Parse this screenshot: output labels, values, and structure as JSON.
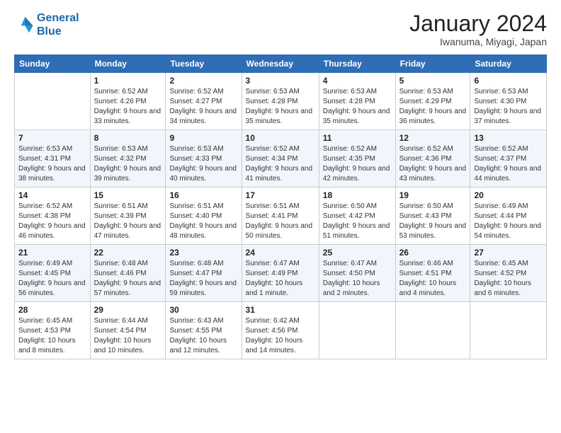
{
  "logo": {
    "line1": "General",
    "line2": "Blue"
  },
  "title": "January 2024",
  "location": "Iwanuma, Miyagi, Japan",
  "days_of_week": [
    "Sunday",
    "Monday",
    "Tuesday",
    "Wednesday",
    "Thursday",
    "Friday",
    "Saturday"
  ],
  "weeks": [
    [
      {
        "day": "",
        "sunrise": "",
        "sunset": "",
        "daylight": ""
      },
      {
        "day": "1",
        "sunrise": "Sunrise: 6:52 AM",
        "sunset": "Sunset: 4:26 PM",
        "daylight": "Daylight: 9 hours and 33 minutes."
      },
      {
        "day": "2",
        "sunrise": "Sunrise: 6:52 AM",
        "sunset": "Sunset: 4:27 PM",
        "daylight": "Daylight: 9 hours and 34 minutes."
      },
      {
        "day": "3",
        "sunrise": "Sunrise: 6:53 AM",
        "sunset": "Sunset: 4:28 PM",
        "daylight": "Daylight: 9 hours and 35 minutes."
      },
      {
        "day": "4",
        "sunrise": "Sunrise: 6:53 AM",
        "sunset": "Sunset: 4:28 PM",
        "daylight": "Daylight: 9 hours and 35 minutes."
      },
      {
        "day": "5",
        "sunrise": "Sunrise: 6:53 AM",
        "sunset": "Sunset: 4:29 PM",
        "daylight": "Daylight: 9 hours and 36 minutes."
      },
      {
        "day": "6",
        "sunrise": "Sunrise: 6:53 AM",
        "sunset": "Sunset: 4:30 PM",
        "daylight": "Daylight: 9 hours and 37 minutes."
      }
    ],
    [
      {
        "day": "7",
        "sunrise": "Sunrise: 6:53 AM",
        "sunset": "Sunset: 4:31 PM",
        "daylight": "Daylight: 9 hours and 38 minutes."
      },
      {
        "day": "8",
        "sunrise": "Sunrise: 6:53 AM",
        "sunset": "Sunset: 4:32 PM",
        "daylight": "Daylight: 9 hours and 39 minutes."
      },
      {
        "day": "9",
        "sunrise": "Sunrise: 6:53 AM",
        "sunset": "Sunset: 4:33 PM",
        "daylight": "Daylight: 9 hours and 40 minutes."
      },
      {
        "day": "10",
        "sunrise": "Sunrise: 6:52 AM",
        "sunset": "Sunset: 4:34 PM",
        "daylight": "Daylight: 9 hours and 41 minutes."
      },
      {
        "day": "11",
        "sunrise": "Sunrise: 6:52 AM",
        "sunset": "Sunset: 4:35 PM",
        "daylight": "Daylight: 9 hours and 42 minutes."
      },
      {
        "day": "12",
        "sunrise": "Sunrise: 6:52 AM",
        "sunset": "Sunset: 4:36 PM",
        "daylight": "Daylight: 9 hours and 43 minutes."
      },
      {
        "day": "13",
        "sunrise": "Sunrise: 6:52 AM",
        "sunset": "Sunset: 4:37 PM",
        "daylight": "Daylight: 9 hours and 44 minutes."
      }
    ],
    [
      {
        "day": "14",
        "sunrise": "Sunrise: 6:52 AM",
        "sunset": "Sunset: 4:38 PM",
        "daylight": "Daylight: 9 hours and 46 minutes."
      },
      {
        "day": "15",
        "sunrise": "Sunrise: 6:51 AM",
        "sunset": "Sunset: 4:39 PM",
        "daylight": "Daylight: 9 hours and 47 minutes."
      },
      {
        "day": "16",
        "sunrise": "Sunrise: 6:51 AM",
        "sunset": "Sunset: 4:40 PM",
        "daylight": "Daylight: 9 hours and 48 minutes."
      },
      {
        "day": "17",
        "sunrise": "Sunrise: 6:51 AM",
        "sunset": "Sunset: 4:41 PM",
        "daylight": "Daylight: 9 hours and 50 minutes."
      },
      {
        "day": "18",
        "sunrise": "Sunrise: 6:50 AM",
        "sunset": "Sunset: 4:42 PM",
        "daylight": "Daylight: 9 hours and 51 minutes."
      },
      {
        "day": "19",
        "sunrise": "Sunrise: 6:50 AM",
        "sunset": "Sunset: 4:43 PM",
        "daylight": "Daylight: 9 hours and 53 minutes."
      },
      {
        "day": "20",
        "sunrise": "Sunrise: 6:49 AM",
        "sunset": "Sunset: 4:44 PM",
        "daylight": "Daylight: 9 hours and 54 minutes."
      }
    ],
    [
      {
        "day": "21",
        "sunrise": "Sunrise: 6:49 AM",
        "sunset": "Sunset: 4:45 PM",
        "daylight": "Daylight: 9 hours and 56 minutes."
      },
      {
        "day": "22",
        "sunrise": "Sunrise: 6:48 AM",
        "sunset": "Sunset: 4:46 PM",
        "daylight": "Daylight: 9 hours and 57 minutes."
      },
      {
        "day": "23",
        "sunrise": "Sunrise: 6:48 AM",
        "sunset": "Sunset: 4:47 PM",
        "daylight": "Daylight: 9 hours and 59 minutes."
      },
      {
        "day": "24",
        "sunrise": "Sunrise: 6:47 AM",
        "sunset": "Sunset: 4:49 PM",
        "daylight": "Daylight: 10 hours and 1 minute."
      },
      {
        "day": "25",
        "sunrise": "Sunrise: 6:47 AM",
        "sunset": "Sunset: 4:50 PM",
        "daylight": "Daylight: 10 hours and 2 minutes."
      },
      {
        "day": "26",
        "sunrise": "Sunrise: 6:46 AM",
        "sunset": "Sunset: 4:51 PM",
        "daylight": "Daylight: 10 hours and 4 minutes."
      },
      {
        "day": "27",
        "sunrise": "Sunrise: 6:45 AM",
        "sunset": "Sunset: 4:52 PM",
        "daylight": "Daylight: 10 hours and 6 minutes."
      }
    ],
    [
      {
        "day": "28",
        "sunrise": "Sunrise: 6:45 AM",
        "sunset": "Sunset: 4:53 PM",
        "daylight": "Daylight: 10 hours and 8 minutes."
      },
      {
        "day": "29",
        "sunrise": "Sunrise: 6:44 AM",
        "sunset": "Sunset: 4:54 PM",
        "daylight": "Daylight: 10 hours and 10 minutes."
      },
      {
        "day": "30",
        "sunrise": "Sunrise: 6:43 AM",
        "sunset": "Sunset: 4:55 PM",
        "daylight": "Daylight: 10 hours and 12 minutes."
      },
      {
        "day": "31",
        "sunrise": "Sunrise: 6:42 AM",
        "sunset": "Sunset: 4:56 PM",
        "daylight": "Daylight: 10 hours and 14 minutes."
      },
      {
        "day": "",
        "sunrise": "",
        "sunset": "",
        "daylight": ""
      },
      {
        "day": "",
        "sunrise": "",
        "sunset": "",
        "daylight": ""
      },
      {
        "day": "",
        "sunrise": "",
        "sunset": "",
        "daylight": ""
      }
    ]
  ]
}
